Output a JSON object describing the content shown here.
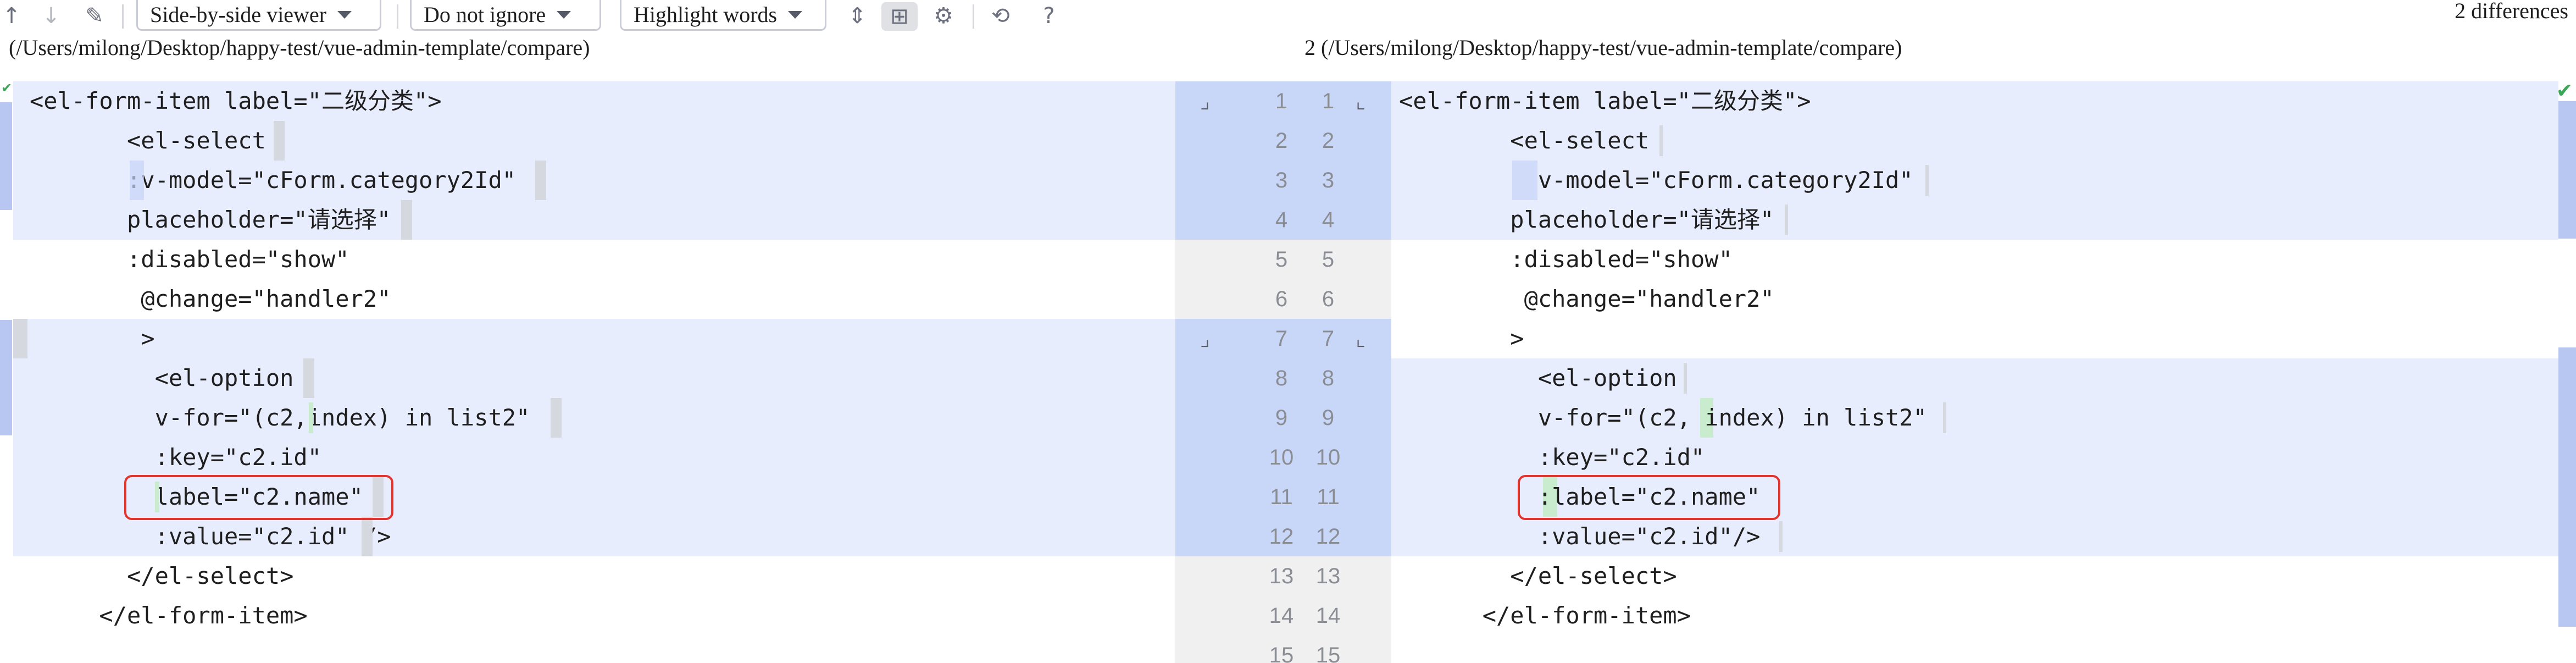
{
  "toolbar": {
    "viewer_label": "Side-by-side viewer",
    "ignore_label": "Do not ignore",
    "highlight_label": "Highlight words",
    "differences": "2 differences",
    "icons": [
      "arrow-up-icon",
      "arrow-down-icon",
      "edit-icon",
      "collapse-icon",
      "sync-scroll-icon",
      "gear-icon",
      "revert-icon",
      "help-icon"
    ]
  },
  "paths": {
    "left": "(/Users/milong/Desktop/happy-test/vue-admin-template/compare)",
    "right": "2 (/Users/milong/Desktop/happy-test/vue-admin-template/compare)"
  },
  "left_lines": [
    "<el-form-item label=\"二级分类\">",
    "       <el-select",
    "       :v-model=\"cForm.category2Id\"",
    "       placeholder=\"请选择\"",
    "       :disabled=\"show\"",
    "        @change=\"handler2\"",
    "        >",
    "         <el-option",
    "         v-for=\"(c2,index) in list2\"",
    "         :key=\"c2.id\"",
    "         label=\"c2.name\"",
    "         :value=\"c2.id\" />",
    "       </el-select>",
    "     </el-form-item>"
  ],
  "right_lines": [
    "<el-form-item label=\"二级分类\">",
    "        <el-select",
    "          v-model=\"cForm.category2Id\"",
    "        placeholder=\"请选择\"",
    "        :disabled=\"show\"",
    "         @change=\"handler2\"",
    "        >",
    "          <el-option",
    "          v-for=\"(c2, index) in list2\"",
    "          :key=\"c2.id\"",
    "          :label=\"c2.name\"",
    "          :value=\"c2.id\"/>",
    "        </el-select>",
    "      </el-form-item>"
  ],
  "line_numbers": [
    "1",
    "2",
    "3",
    "4",
    "5",
    "6",
    "7",
    "8",
    "9",
    "10",
    "11",
    "12",
    "13",
    "14",
    "15"
  ]
}
